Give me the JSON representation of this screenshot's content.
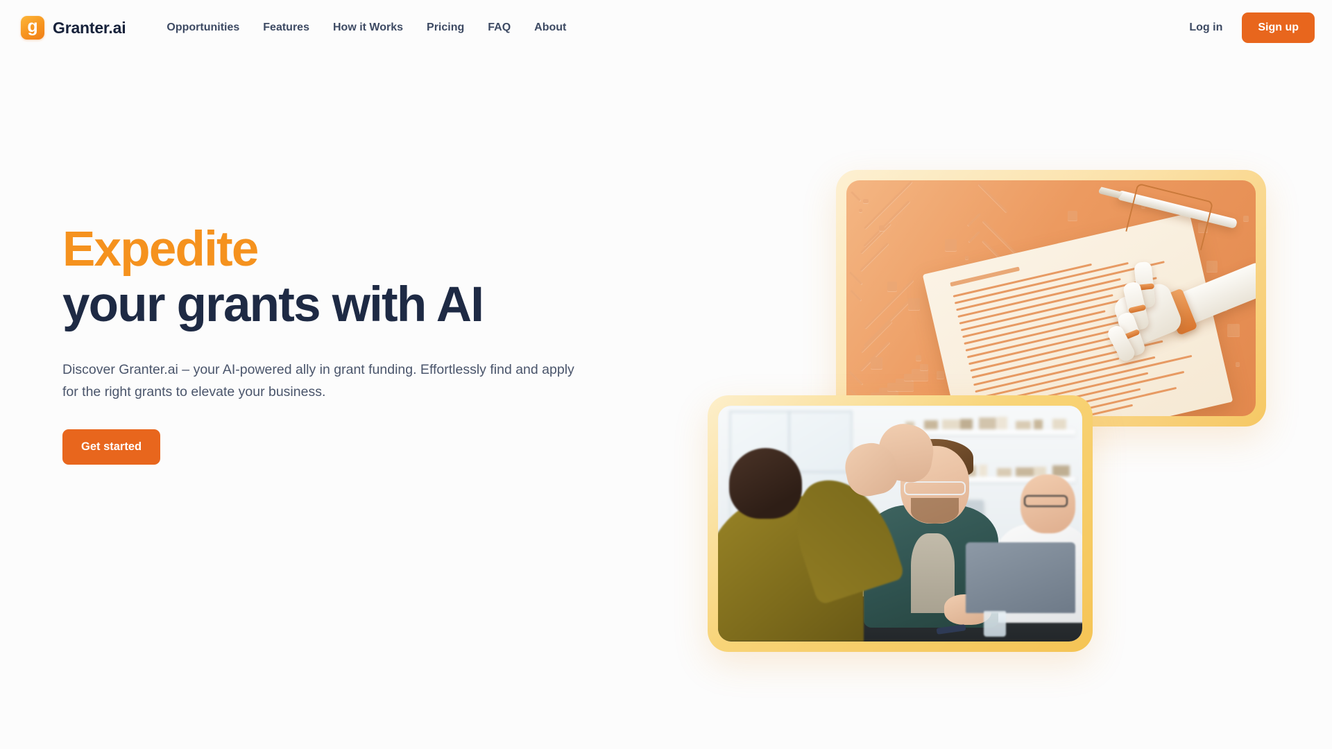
{
  "nav": {
    "logo_icon": "granter-logo-icon",
    "logo_letter": "g",
    "brand": "Granter.ai",
    "links": [
      {
        "label": "Opportunities"
      },
      {
        "label": "Features"
      },
      {
        "label": "How it Works"
      },
      {
        "label": "Pricing"
      },
      {
        "label": "FAQ"
      },
      {
        "label": "About"
      }
    ],
    "login_label": "Log in",
    "signup_label": "Sign up"
  },
  "hero": {
    "title_accent": "Expedite",
    "title_rest": "your grants with AI",
    "subtitle": "Discover Granter.ai – your AI-powered ally in grant funding. Effortlessly find and apply for the right grants to elevate your business.",
    "cta_label": "Get started"
  },
  "media": {
    "ai_card_alt": "robotic hand signing a grant document over a circuit board",
    "team_card_alt": "colleagues high-fiving at an office desk with a laptop"
  },
  "colors": {
    "brand_orange": "#F5921E",
    "cta_orange": "#E8661D",
    "heading_navy": "#1E2A44",
    "body_text": "#4A556B",
    "nav_text": "#3D4A63",
    "card_frame_light": "#FBE1A8",
    "card_frame_gold": "#F6C864",
    "page_background": "#FCFCFC"
  }
}
